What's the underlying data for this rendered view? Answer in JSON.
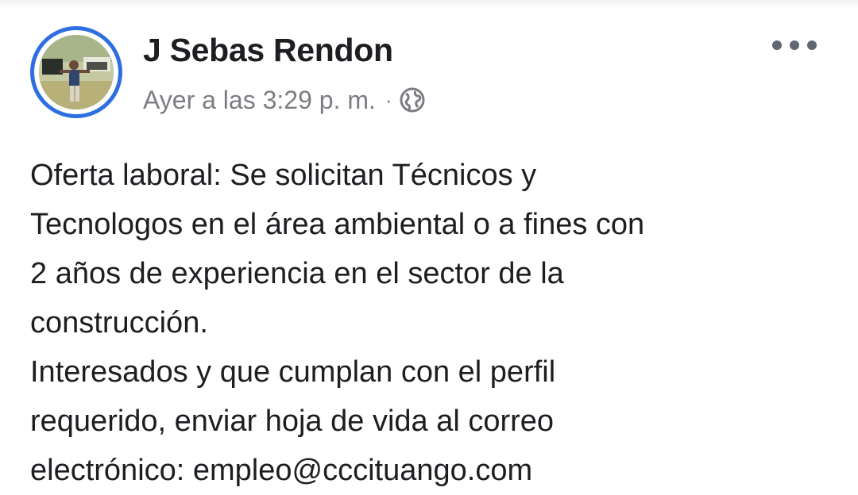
{
  "post": {
    "author": "J Sebas Rendon",
    "timestamp": "Ayer a las 3:29 p. m.",
    "separator": "·",
    "audience_icon": "globe-icon",
    "more_icon": "more-options-icon",
    "text_lines": [
      "Oferta laboral: Se solicitan Técnicos y",
      "Tecnologos en el área ambiental o a fines con",
      "2 años de experiencia en el sector de la",
      "construcción.",
      "Interesados y que cumplan con el perfil",
      "requerido, enviar hoja de vida al correo",
      "electrónico: empleo@cccituango.com"
    ]
  },
  "colors": {
    "avatar_ring": "#2d6ee0",
    "author": "#1c1e21",
    "meta": "#7a7d82",
    "body_text": "#1c1e21"
  }
}
